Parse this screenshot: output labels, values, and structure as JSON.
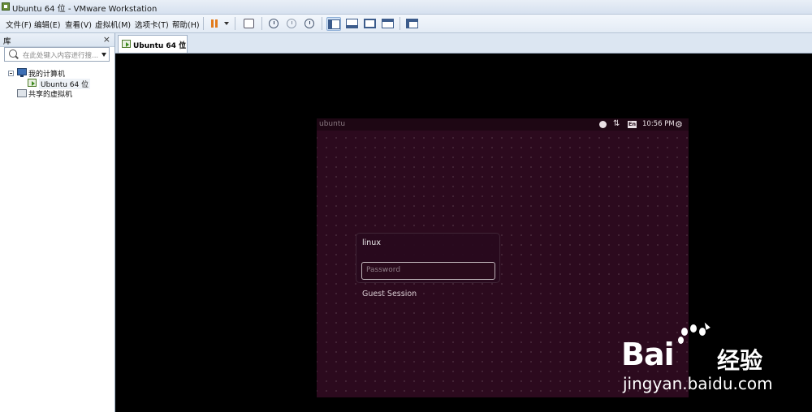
{
  "window": {
    "title": "Ubuntu 64 位 - VMware Workstation"
  },
  "menu": {
    "items": [
      "文件(F)",
      "编辑(E)",
      "查看(V)",
      "虚拟机(M)",
      "选项卡(T)",
      "帮助(H)"
    ]
  },
  "toolbar": {
    "icons": [
      "pause-icon",
      "send-keys-icon",
      "snapshot-icon",
      "revert-snapshot-icon",
      "snapshot-manager-icon",
      "console-view-icon",
      "thumbnail-view-icon",
      "fullscreen-icon",
      "unity-icon",
      "library-view-icon"
    ]
  },
  "library": {
    "title": "库",
    "close": "×",
    "search_placeholder": "在此处键入内容进行搜...",
    "tree": {
      "my_computer": "我的计算机",
      "vm": "Ubuntu 64 位",
      "shared": "共享的虚拟机"
    }
  },
  "tabs": [
    {
      "label": "Ubuntu 64 位",
      "close": "×"
    }
  ],
  "guest": {
    "panel_label": "ubuntu",
    "keyboard": "En",
    "time": "10:56 PM",
    "network_glyph": "⇅",
    "gear_glyph": "⚙",
    "login": {
      "username": "linux",
      "password_placeholder": "Password",
      "guest_session": "Guest Session"
    }
  },
  "watermark": {
    "brand": "Bai",
    "brand_tail": "经验",
    "url": "jingyan.baidu.com"
  }
}
